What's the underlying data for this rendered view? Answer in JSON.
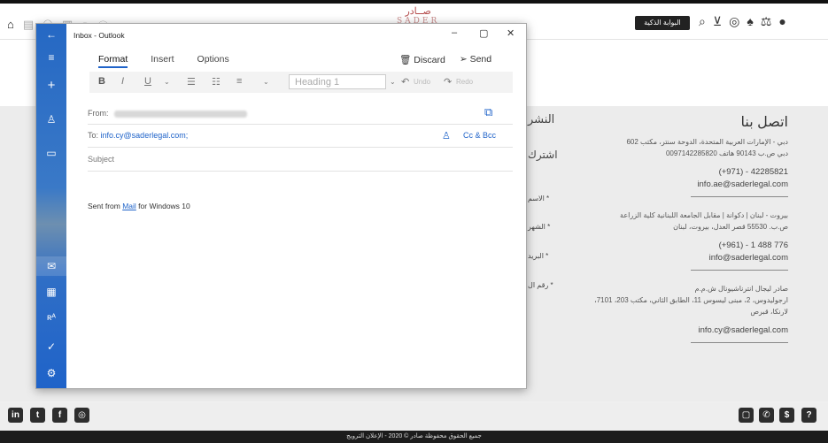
{
  "website": {
    "logo_ar": "صــادر",
    "logo_en": "SADER",
    "portal_button": "البوابة الذكية",
    "contact_title": "اتصل بنا",
    "offices": [
      {
        "address1": "دبي - الإمارات العربية المتحدة، الدوحة سنتر، مكتب 602",
        "address2": "دبي ص.ب 90143 هاتف 0097142285820",
        "phone": "(+971) - 42285821",
        "email": "info.ae@saderlegal.com"
      },
      {
        "address1": "بيروت - لبنان | دكوانة | مقابل الجامعة اللبنانية كلية الزراعة",
        "address2": "ص.ب. 55530 قصر العدل، بيروت، لبنان",
        "phone": "(+961) - 1 488 776",
        "email": "info@saderlegal.com"
      },
      {
        "address1": "صادر ليجال انترناشيونال ش.م.م",
        "address2": "ارجوليدوس، 2، مبنى ليسوس 11، الطابق الثاني، مكتب 203، 7101،",
        "address3": "لارنكا، قبرص",
        "email": "info.cy@saderlegal.com"
      }
    ],
    "partial_headings": [
      "النشر",
      "اشترك"
    ],
    "partial_labels": [
      "* الاسم",
      "* الشهر",
      "* البريد",
      "* رقم ال"
    ],
    "footer_text": "جميع الحقوق محفوظة صادر © 2020   -   الإعلان الترويج"
  },
  "mail": {
    "window_title": "Inbox - Outlook",
    "tabs": [
      "Format",
      "Insert",
      "Options"
    ],
    "discard_label": "Discard",
    "send_label": "Send",
    "heading_value": "Heading 1",
    "undo_label": "Undo",
    "redo_label": "Redo",
    "from_label": "From:",
    "to_label": "To:",
    "to_value": "info.cy@saderlegal.com;",
    "cc_label": "Cc & Bcc",
    "subject_placeholder": "Subject",
    "body_prefix": "Sent from ",
    "body_link": "Mail",
    "body_suffix": " for Windows 10"
  }
}
